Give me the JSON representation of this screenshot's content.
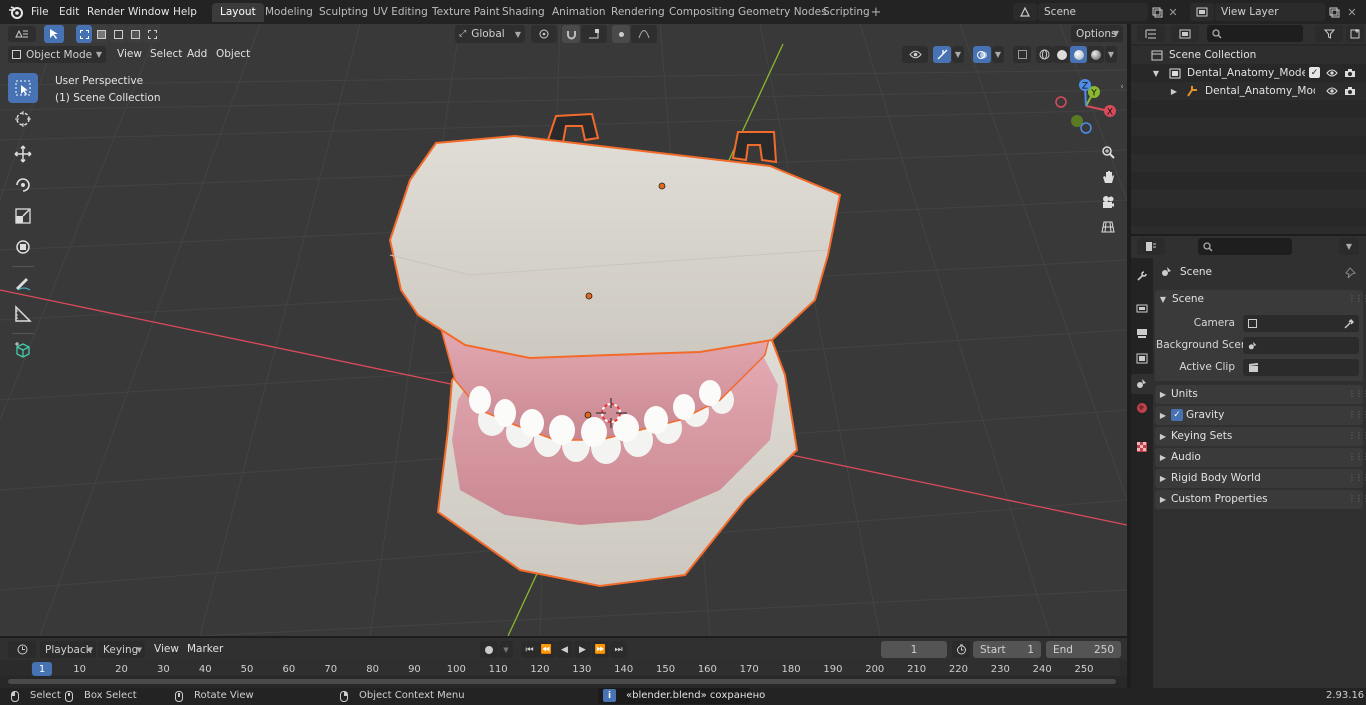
{
  "topbar": {
    "menus": [
      "File",
      "Edit",
      "Render",
      "Window",
      "Help"
    ],
    "workspaces": [
      "Layout",
      "Modeling",
      "Sculpting",
      "UV Editing",
      "Texture Paint",
      "Shading",
      "Animation",
      "Rendering",
      "Compositing",
      "Geometry Nodes",
      "Scripting"
    ],
    "active_workspace": "Layout",
    "add_workspace_glyph": "+",
    "scene_name": "Scene",
    "view_layer_name": "View Layer"
  },
  "viewport": {
    "mode": "Object Mode",
    "menus": [
      "View",
      "Select",
      "Add",
      "Object"
    ],
    "transform_orientation": "Global",
    "options_label": "Options",
    "overlay_title": "User Perspective",
    "overlay_subtitle": "(1) Scene Collection",
    "gizmo_axes": [
      "X",
      "Y",
      "Z"
    ]
  },
  "outliner": {
    "root": "Scene Collection",
    "items": [
      {
        "label": "Dental_Anatomy_Model_Simu"
      },
      {
        "label": "Dental_Anatomy_Model_"
      }
    ]
  },
  "properties": {
    "context_label": "Scene",
    "panel_title": "Scene",
    "fields": [
      {
        "label": "Camera"
      },
      {
        "label": "Background Scene"
      },
      {
        "label": "Active Clip"
      }
    ],
    "sections": [
      "Units",
      "Gravity",
      "Keying Sets",
      "Audio",
      "Rigid Body World",
      "Custom Properties"
    ],
    "gravity_enabled": true
  },
  "timeline": {
    "menus": [
      "Playback",
      "Keying",
      "View",
      "Marker"
    ],
    "current_frame": "1",
    "start_label": "Start",
    "start_value": "1",
    "end_label": "End",
    "end_value": "250",
    "ruler_ticks": [
      "1",
      "10",
      "20",
      "30",
      "40",
      "50",
      "60",
      "70",
      "80",
      "90",
      "100",
      "110",
      "120",
      "130",
      "140",
      "150",
      "160",
      "170",
      "180",
      "190",
      "200",
      "210",
      "220",
      "230",
      "240",
      "250"
    ]
  },
  "statusbar": {
    "hints": [
      "Select",
      "Box Select",
      "Rotate View",
      "Object Context Menu"
    ],
    "message": "«blender.blend» сохранено",
    "version": "2.93.16"
  },
  "colors": {
    "selection_outline": "#f26b2b",
    "accent_blue": "#4772b3",
    "axis_x": "#d94a5a",
    "axis_y": "#8ab82f",
    "axis_z": "#4d8ee8"
  }
}
